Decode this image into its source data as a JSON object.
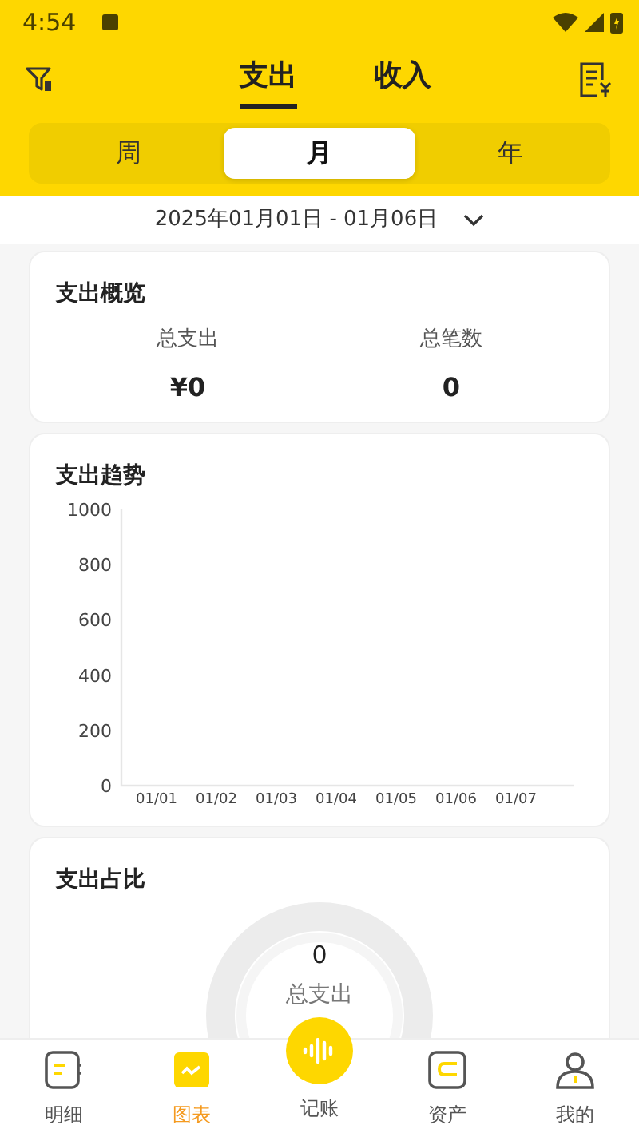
{
  "status_bar": {
    "time": "4:54"
  },
  "header": {
    "tabs": [
      {
        "label": "支出",
        "selected": true
      },
      {
        "label": "收入",
        "selected": false
      }
    ]
  },
  "period_tabs": [
    {
      "label": "周",
      "selected": false
    },
    {
      "label": "月",
      "selected": true
    },
    {
      "label": "年",
      "selected": false
    }
  ],
  "date_range": "2025年01月01日 - 01月06日",
  "overview": {
    "title": "支出概览",
    "stats": [
      {
        "label": "总支出",
        "value": "¥0"
      },
      {
        "label": "总笔数",
        "value": "0"
      }
    ]
  },
  "trend": {
    "title": "支出趋势",
    "chart_data": {
      "type": "line",
      "categories": [
        "01/01",
        "01/02",
        "01/03",
        "01/04",
        "01/05",
        "01/06",
        "01/07"
      ],
      "ylim": [
        0,
        1000
      ],
      "yticks": [
        0,
        200,
        400,
        600,
        800,
        1000
      ]
    }
  },
  "share": {
    "title": "支出占比",
    "total": "0",
    "total_label": "总支出"
  },
  "bottom_nav": [
    {
      "label": "明细",
      "kind": "list",
      "selected": false
    },
    {
      "label": "图表",
      "kind": "chart",
      "selected": true
    },
    {
      "label": "记账",
      "kind": "record",
      "selected": false
    },
    {
      "label": "资产",
      "kind": "wallet",
      "selected": false
    },
    {
      "label": "我的",
      "kind": "person",
      "selected": false
    }
  ]
}
